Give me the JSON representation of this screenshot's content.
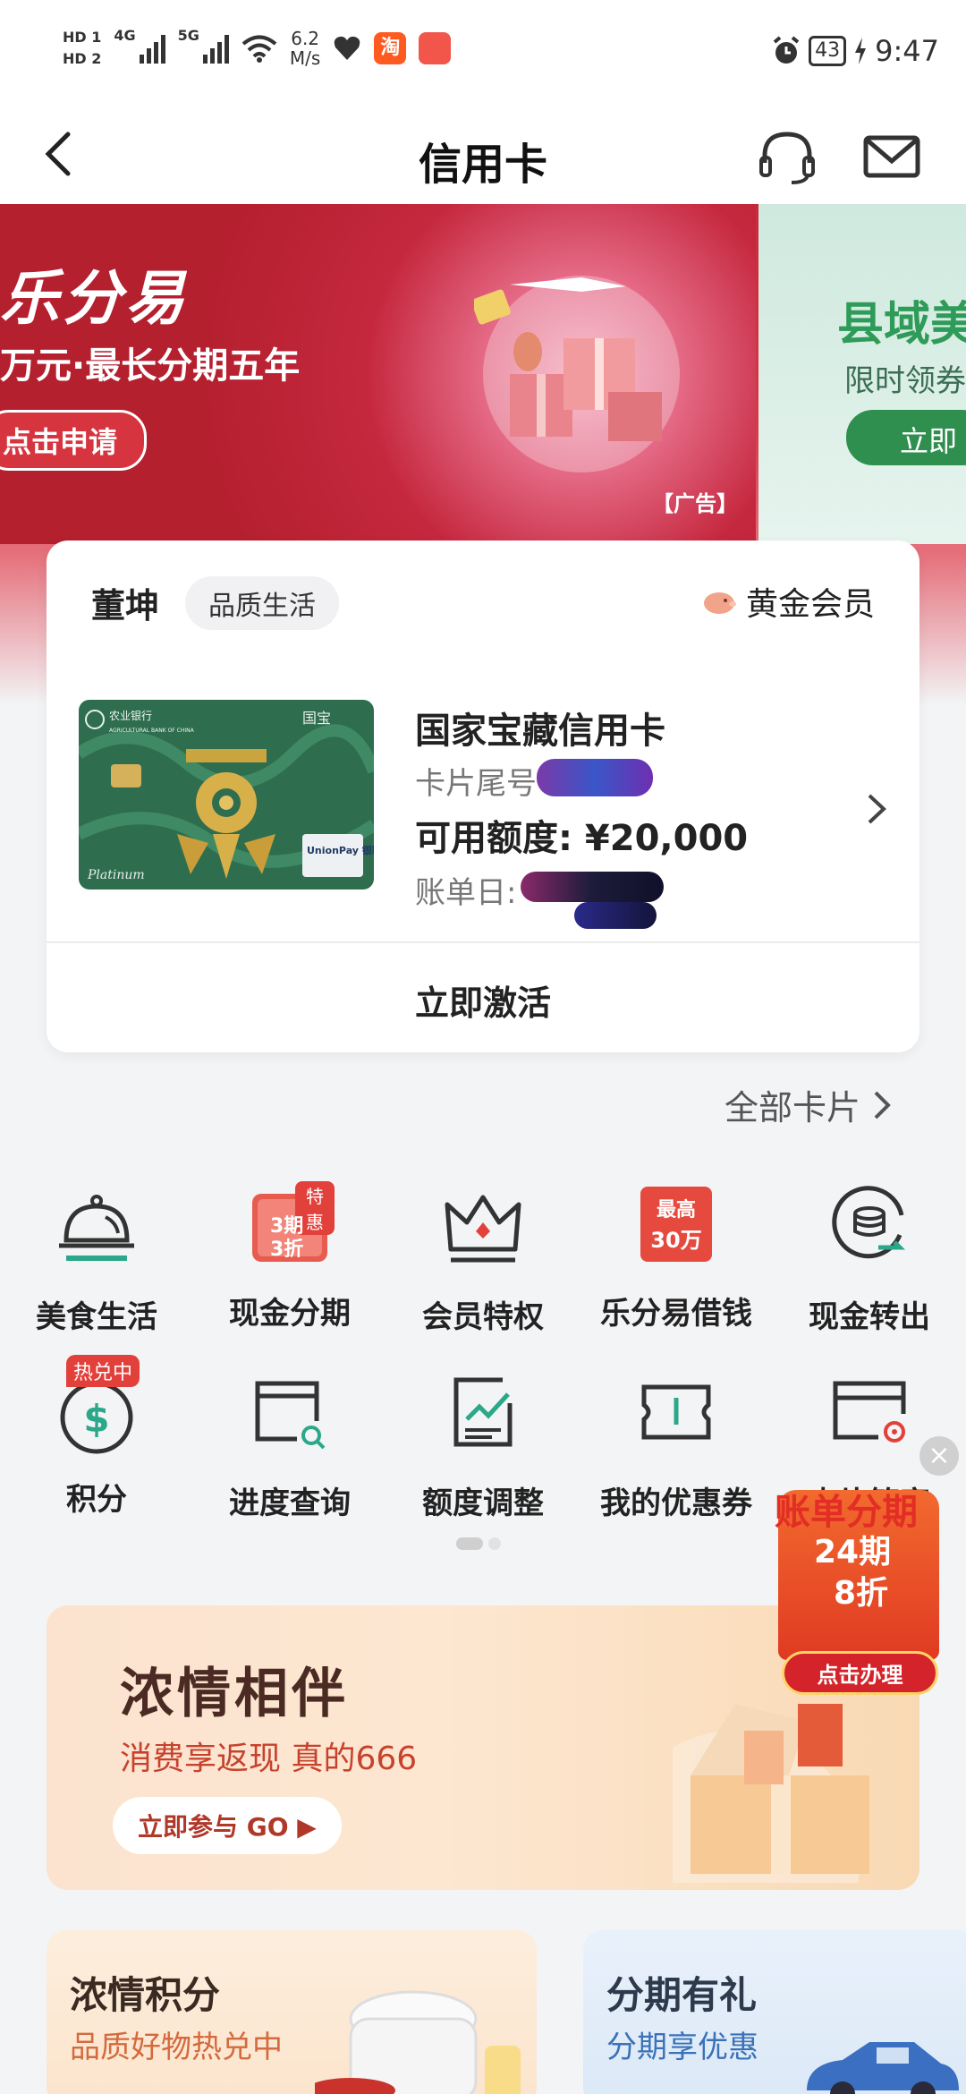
{
  "status_bar": {
    "hd1": "HD",
    "hd1_sub": "1",
    "hd2": "HD",
    "hd2_sub": "2",
    "net1": "4G",
    "net2": "5G",
    "speed_value": "6.2",
    "speed_unit": "M/s",
    "taobao_icon": "淘",
    "battery": "43",
    "time": "9:47"
  },
  "nav": {
    "title": "信用卡",
    "back_icon": "chevron-left-icon",
    "support_icon": "headset-icon",
    "message_icon": "mail-icon"
  },
  "banners": [
    {
      "headline": "乐分易",
      "subline": "万元·最长分期五年",
      "cta": "点击申请",
      "ad_label": "【广告】"
    },
    {
      "headline": "县域美",
      "subline": "限时领券",
      "cta": "立即"
    }
  ],
  "card": {
    "user_name": "董坤",
    "user_tag": "品质生活",
    "member_level": "黄金会员",
    "card_name": "国家宝藏信用卡",
    "tail_label": "卡片尾号",
    "limit_text": "可用额度: ¥20,000",
    "bill_label": "账单日:",
    "activate_label": "立即激活",
    "card_image": {
      "bank_cn": "农业银行",
      "bank_en": "AGRICULTURAL BANK OF CHINA",
      "title_cn": "国宝",
      "unionpay": "UnionPay 银联",
      "tier": "Platinum"
    }
  },
  "all_cards": "全部卡片",
  "grid": [
    {
      "label": "美食生活",
      "icon": "cloche-icon"
    },
    {
      "label": "现金分期",
      "icon": "installment-icon",
      "icon_top": "特惠",
      "icon_l1": "3期",
      "icon_l2": "3折"
    },
    {
      "label": "会员特权",
      "icon": "crown-icon"
    },
    {
      "label": "乐分易借钱",
      "icon": "loan-icon",
      "icon_l1": "最高",
      "icon_l2": "30万"
    },
    {
      "label": "现金转出",
      "icon": "coin-transfer-icon"
    },
    {
      "label": "积分",
      "icon": "points-icon",
      "badge": "热兑中"
    },
    {
      "label": "进度查询",
      "icon": "progress-search-icon"
    },
    {
      "label": "额度调整",
      "icon": "limit-chart-icon"
    },
    {
      "label": "我的优惠券",
      "icon": "coupon-icon"
    },
    {
      "label": "卡片管家",
      "icon": "card-settings-icon"
    }
  ],
  "float_promo": {
    "title": "账单分期",
    "line1": "24期",
    "line2": "8折",
    "button": "点击办理",
    "close": "×"
  },
  "promo": {
    "title": "浓情相伴",
    "subtitle": "消费享返现 真的666",
    "button": "立即参与 GO ▶"
  },
  "bottom_cards": [
    {
      "title": "浓情积分",
      "subtitle": "品质好物热兑中"
    },
    {
      "title": "分期有礼",
      "subtitle": "分期享优惠"
    }
  ],
  "colors": {
    "accent_red": "#d6343f",
    "teal": "#2aa889",
    "gold": "#e6a23c",
    "text_dark": "#222222"
  }
}
